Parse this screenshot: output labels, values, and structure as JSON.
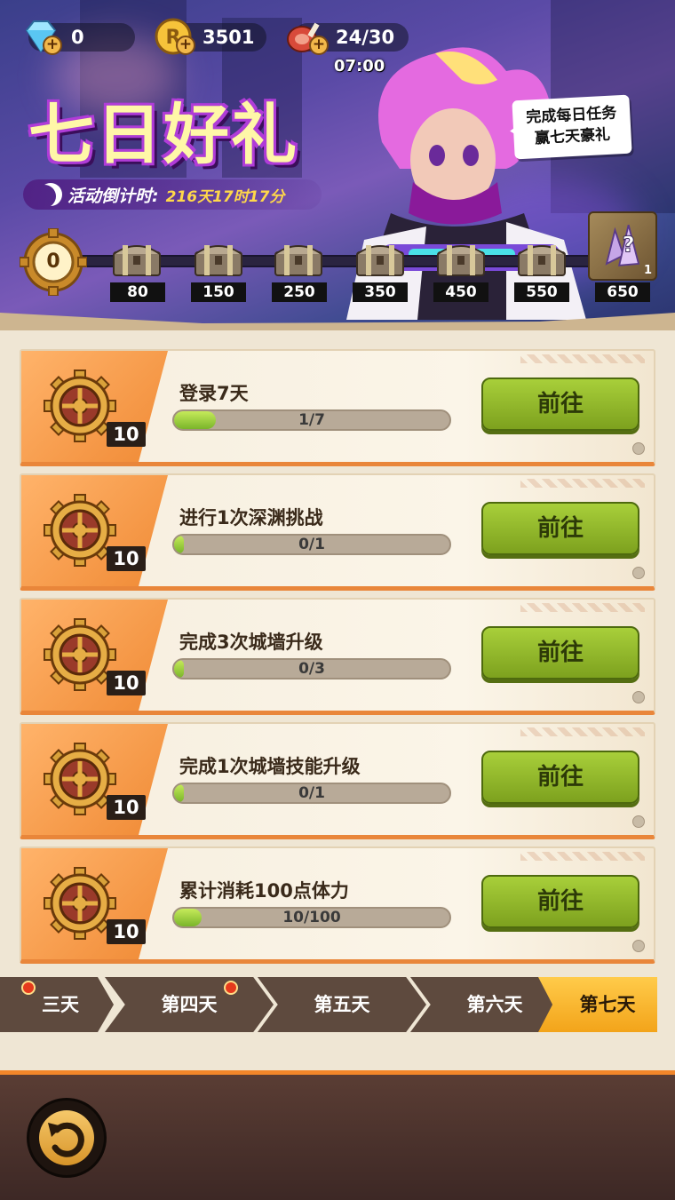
{
  "resources": {
    "diamonds": "0",
    "coins": "3501",
    "stamina": "24/30",
    "stamina_timer": "07:00"
  },
  "event": {
    "title": "七日好礼",
    "countdown_label": "活动倒计时:",
    "countdown_value": "216天17时17分",
    "speech_line1": "完成每日任务",
    "speech_line2": "赢七天豪礼"
  },
  "progress": {
    "current": "0",
    "milestones": [
      "80",
      "150",
      "250",
      "350",
      "450",
      "550",
      "650"
    ],
    "final_reward_count": "1"
  },
  "tasks": [
    {
      "name": "登录7天",
      "progress_text": "1/7",
      "progress": 0.15,
      "reward": "10",
      "button": "前往"
    },
    {
      "name": "进行1次深渊挑战",
      "progress_text": "0/1",
      "progress": 0.0,
      "reward": "10",
      "button": "前往"
    },
    {
      "name": "完成3次城墙升级",
      "progress_text": "0/3",
      "progress": 0.0,
      "reward": "10",
      "button": "前往"
    },
    {
      "name": "完成1次城墙技能升级",
      "progress_text": "0/1",
      "progress": 0.0,
      "reward": "10",
      "button": "前往"
    },
    {
      "name": "累计消耗100点体力",
      "progress_text": "10/100",
      "progress": 0.1,
      "reward": "10",
      "button": "前往"
    }
  ],
  "day_tabs": [
    "三天",
    "第四天",
    "第五天",
    "第六天",
    "第七天"
  ],
  "colors": {
    "accent_orange": "#f08a35",
    "button_green": "#8fb82c",
    "title_yellow": "#fff7a8",
    "countdown_yellow": "#ffd84a"
  }
}
